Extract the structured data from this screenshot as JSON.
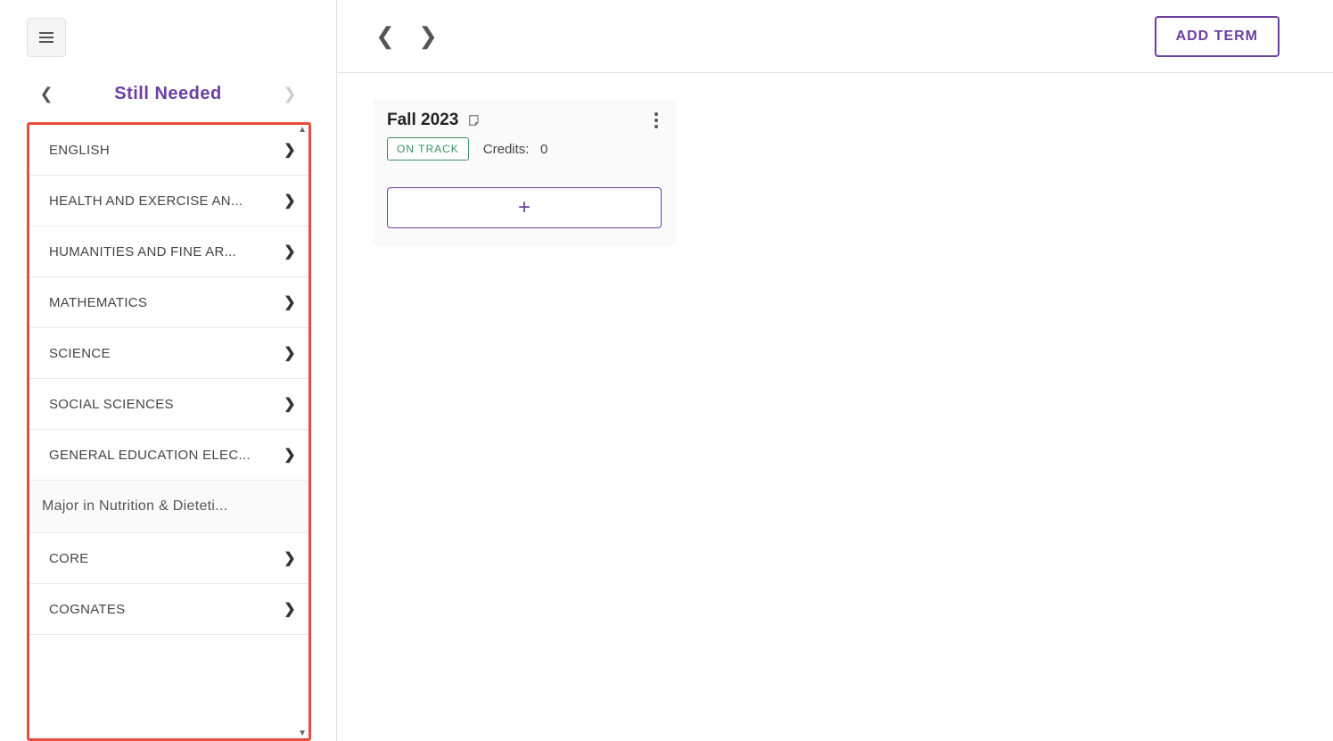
{
  "sidebar": {
    "title": "Still Needed",
    "items": [
      {
        "label": "ENGLISH",
        "type": "item",
        "hasChevron": true
      },
      {
        "label": "HEALTH AND EXERCISE AN...",
        "type": "item",
        "hasChevron": true
      },
      {
        "label": "HUMANITIES AND FINE AR...",
        "type": "item",
        "hasChevron": true
      },
      {
        "label": "MATHEMATICS",
        "type": "item",
        "hasChevron": true
      },
      {
        "label": "SCIENCE",
        "type": "item",
        "hasChevron": true
      },
      {
        "label": "SOCIAL SCIENCES",
        "type": "item",
        "hasChevron": true
      },
      {
        "label": "GENERAL EDUCATION ELEC...",
        "type": "item",
        "hasChevron": true
      },
      {
        "label": "Major in Nutrition & Dieteti...",
        "type": "section-head",
        "hasChevron": false
      },
      {
        "label": "CORE",
        "type": "item",
        "hasChevron": true
      },
      {
        "label": "COGNATES",
        "type": "item",
        "hasChevron": true
      }
    ]
  },
  "header": {
    "add_term_label": "ADD TERM"
  },
  "term": {
    "title": "Fall 2023",
    "status": "ON TRACK",
    "credits_label": "Credits:",
    "credits_value": "0",
    "add_course_label": "+"
  }
}
